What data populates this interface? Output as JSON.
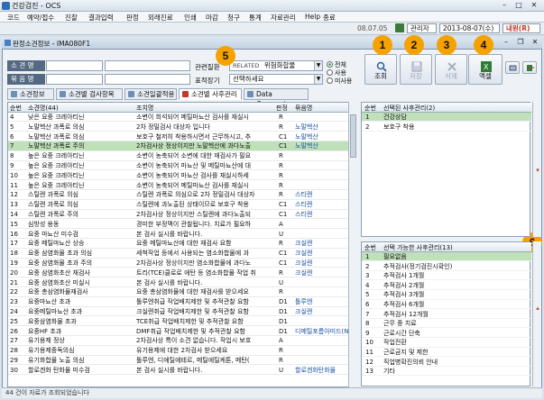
{
  "window": {
    "title": "건강검진 - OCS"
  },
  "menu": [
    "코드",
    "예약/접수",
    "진찰",
    "결과입력",
    "판정",
    "외래진료",
    "인쇄",
    "마감",
    "청구",
    "통계",
    "자료관리",
    "Help",
    "종료"
  ],
  "toolbar": {
    "date_short": "08.07.05",
    "user": "관리자",
    "date": "2013-08-07(수)",
    "mode": "내원(R)"
  },
  "child": {
    "title": "판정소견정보 - IMA080F1"
  },
  "search": {
    "label1": "소 견 명",
    "label2": "묶 음 명",
    "label3": "관련질환",
    "label3_value": "RELATED",
    "label3_combo": "위험화합물",
    "label4": "표적장기",
    "label4_combo": "선택하세요",
    "radio": [
      "전체",
      "사용",
      "미사용"
    ]
  },
  "buttons": [
    {
      "label": "조회",
      "badge": "1",
      "icon": "search-icon",
      "enabled": true
    },
    {
      "label": "저장",
      "badge": "2",
      "icon": "save-icon",
      "enabled": false
    },
    {
      "label": "삭제",
      "badge": "3",
      "icon": "delete-icon",
      "enabled": false
    },
    {
      "label": "엑셀",
      "badge": "4",
      "icon": "excel-icon",
      "enabled": true
    }
  ],
  "search_badge": "5",
  "right_badge": "6",
  "tabs": [
    "소견정보",
    "소견별 검사항목",
    "소견일괄적용",
    "소견별 사후관리",
    "Data Conversion"
  ],
  "grid": {
    "headers": [
      "순번",
      "소견명(44)",
      "조치명",
      "판정",
      "묶음명"
    ],
    "rows": [
      [
        "4",
        "낮은 요중 크레아티닌",
        "소변이 희석되어 메틸마뇨산 검사를 재실시",
        "R",
        ""
      ],
      [
        "5",
        "노말헥산 과폭로 의심",
        "2차 정밀검사 대상자 입니다",
        "R",
        "노말헥산"
      ],
      [
        "6",
        "노말헥산 과폭로 의심",
        "보호구 철저히 착용하시면서 근무하시고, 추",
        "C1",
        "노말헥산"
      ],
      [
        "7",
        "노말헥산 과폭로 주의",
        "2차검사상 정상이지만 노말헥산에 과다노출",
        "C1",
        "노말헥산"
      ],
      [
        "8",
        "높은 요중 크레아티닌",
        "소변이 농축되어 소변에 대한 재검사가 필요",
        "R",
        ""
      ],
      [
        "9",
        "높은 요중 크레아티닌",
        "소변이 농축되어 마뇨산 및 메틸마뇨산에 대",
        "R",
        ""
      ],
      [
        "10",
        "높은 요중 크레아티닌",
        "소변이 농축되어 마뇨산 검사를 재실시하세",
        "R",
        ""
      ],
      [
        "11",
        "높은 요중 크레아티닌",
        "소변이 농축되어 메틸마뇨산 검사를 재실시",
        "R",
        ""
      ],
      [
        "12",
        "스틸렌 과폭로 의심",
        "스틸렌 과폭로 의심으로 2차 정밀검사 대상자",
        "R",
        "스티렌"
      ],
      [
        "13",
        "스틸렌 과폭로 의심",
        "스틸렌에 과노출된 상태이므로 보호구 착용",
        "C1",
        "스티렌"
      ],
      [
        "14",
        "스틸렌 과폭로 주의",
        "2차검사상 정상이지만 스틸렌에 과다노출되",
        "C1",
        "스티렌"
      ],
      [
        "15",
        "심방성 용동",
        "경미한 부정맥이 관찰됩니다. 치료가 필요하",
        "A",
        ""
      ],
      [
        "16",
        "요중 마뇨산 미수검",
        "본 검사 실시를 바랍니다.",
        "U",
        ""
      ],
      [
        "17",
        "요중 메틸마뇨산 상승",
        "요중 메틸마뇨산에 대한 재검사 요함",
        "R",
        "크실렌"
      ],
      [
        "18",
        "요중 삼염화물 초과 의심",
        "세척작업 등에서 사용되는 염소화합물에 과",
        "C1",
        "크실렌"
      ],
      [
        "19",
        "요중 삼염화물 초과 주의",
        "2차검사상 정상이지만 염소화합물에 과다노",
        "C1",
        "크실렌"
      ],
      [
        "20",
        "요중 삼염화초산 재검사",
        "트리(TCE)클로로 에탄 등 염소화합물 작업 취",
        "R",
        "크실렌"
      ],
      [
        "21",
        "요중 삼염화초산 미실시",
        "본 검사 실시를 바랍니다.",
        "U",
        ""
      ],
      [
        "22",
        "요중 총삼염화물재검사",
        "요중 총삼염화물에 대한 재검사를 받으세요",
        "R",
        ""
      ],
      [
        "23",
        "요중마뇨산 초과",
        "톨루엔취급 작업배치제한 및 추적관찰 요함",
        "D1",
        "톨루엔"
      ],
      [
        "24",
        "요중메틸마뇨산 초과",
        "크실렌취급 작업배치제한 및 추적관찰 요함",
        "D1",
        "크실렌"
      ],
      [
        "25",
        "요중삼염화물 초과",
        "TCE취급 작업배치제한 및 추적관찰 요함",
        "D1",
        ""
      ],
      [
        "26",
        "요중HF 초과",
        "DMF취급 작업배치제한 및 추적관찰 요함",
        "D1",
        "디메틸포름아미드(N,"
      ],
      [
        "27",
        "유기용제 정상",
        "2차검사상 특이 소견 없습니다. 작업시 보호",
        "A",
        ""
      ],
      [
        "28",
        "유기용제중독의심",
        "유기용제에 대한 2차검사 받으세요",
        "R",
        ""
      ],
      [
        "29",
        "유기화합물 노출 의심",
        "톨루엔, 디에틸에테르, 메틸에틸케톤, 메탄(",
        "R",
        ""
      ],
      [
        "30",
        "할로겐화 탄화물 미수검",
        "본 검사 실시를 바랍니다.",
        "U",
        "할로겐화탄화물"
      ]
    ],
    "selected_row": 3
  },
  "selected_panel": {
    "header_no": "순번",
    "header_name": "선택된 사후관리(2)",
    "items": [
      [
        "1",
        "건강상담"
      ],
      [
        "2",
        "보호구 착용"
      ]
    ]
  },
  "available_panel": {
    "header_no": "순번",
    "header_name": "선택 가능한 사후관리(13)",
    "items": [
      [
        "1",
        "필요없음"
      ],
      [
        "2",
        "추적검사(정기검진시확인)"
      ],
      [
        "3",
        "추적검사 1개월"
      ],
      [
        "4",
        "추적검사 2개월"
      ],
      [
        "5",
        "추적검사 3개월"
      ],
      [
        "6",
        "추적검사 6개월"
      ],
      [
        "7",
        "추적검사 12개월"
      ],
      [
        "8",
        "근무 중 치료"
      ],
      [
        "9",
        "근로시간 단축"
      ],
      [
        "10",
        "작업전환"
      ],
      [
        "11",
        "근로금지 및 제한"
      ],
      [
        "12",
        "직업병확진의뢰 안내"
      ],
      [
        "13",
        "기타"
      ]
    ]
  },
  "status": "44 건이 자료가 조회되었습니다"
}
